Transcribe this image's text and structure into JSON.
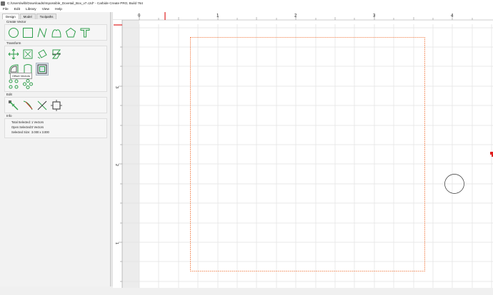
{
  "window": {
    "title": "C:/Users/wilb/Downloads/Impossible_Dovetail_Box_v7.c2d* - Carbide Create PRO, Build 764"
  },
  "menu": [
    "File",
    "Edit",
    "Library",
    "View",
    "Help"
  ],
  "tabs": [
    {
      "label": "Design",
      "active": true
    },
    {
      "label": "Model",
      "active": false
    },
    {
      "label": "Toolpaths",
      "active": false
    }
  ],
  "sections": {
    "create_vector": "Create Vector",
    "transform": "Transform",
    "edit": "Edit",
    "info": "Info"
  },
  "tooltip": "Offset Vectors",
  "info": {
    "total_selected_label": "Total Selected:",
    "total_selected_value": "1 Vectors",
    "open_selected_label": "Open Selected:",
    "open_selected_value": "0 Vectors",
    "selected_size_label": "Selected Size:",
    "selected_size_value": "3.000 x 3.000"
  },
  "ruler": {
    "top_labels": [
      "0",
      "1",
      "2",
      "3",
      "4"
    ],
    "left_labels": [
      "3",
      "2",
      "1"
    ]
  },
  "icons": {
    "create": [
      "circle-icon",
      "rectangle-icon",
      "polyline-icon",
      "curve-icon",
      "polygon-icon",
      "text-icon"
    ],
    "transform_row1": [
      "move-icon",
      "scale-icon",
      "rotate-icon",
      "mirror-icon"
    ],
    "transform_row2": [
      "offset-icon",
      "join-icon",
      "offset-vectors-icon"
    ],
    "transform_row3": [
      "align-icon",
      "group-icon"
    ],
    "edit": [
      "node-edit-icon",
      "trim-icon",
      "cut-icon",
      "boundary-icon"
    ]
  },
  "colors": {
    "accent_green": "#2e9e4a",
    "selection_orange": "#f06a2a",
    "ruler_marker_red": "#e02020",
    "grid": "#e2e2e2"
  }
}
